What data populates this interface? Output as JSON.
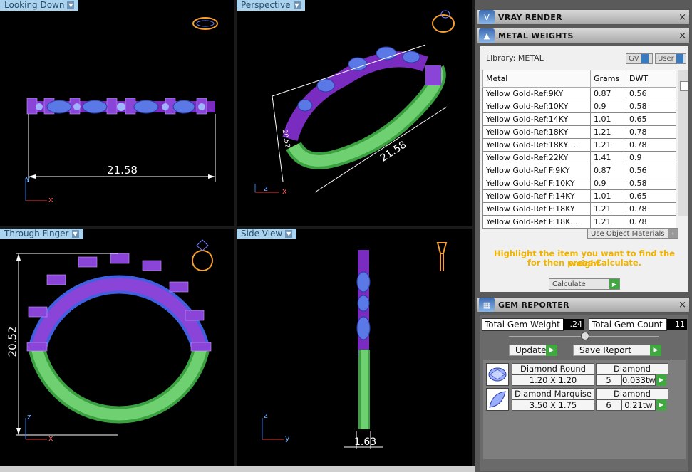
{
  "viewports": {
    "top_left": {
      "label": "Looking Down",
      "dim": "21.58",
      "axis1": "y",
      "axis2": "x"
    },
    "top_right": {
      "label": "Perspective",
      "dim": "21.58",
      "dim_small": "20.52",
      "axis1": "z",
      "axis2": "x"
    },
    "bottom_left": {
      "label": "Through Finger",
      "dim": "20.52",
      "axis1": "z",
      "axis2": "x"
    },
    "bottom_right": {
      "label": "Side View",
      "dim": "1.63",
      "axis1": "z",
      "axis2": "y"
    }
  },
  "panel": {
    "vray": {
      "title": "VRAY RENDER",
      "close": "×",
      "icon": "vray-icon"
    },
    "metal": {
      "title": "METAL WEIGHTS",
      "close": "×",
      "icon": "flask-icon",
      "library": "Library: METAL",
      "gv_label": "GV",
      "user_label": "User",
      "columns": [
        "Metal",
        "Grams",
        "DWT"
      ],
      "rows": [
        [
          "Yellow Gold-Ref:9KY",
          "0.87",
          "0.56"
        ],
        [
          "Yellow Gold-Ref:10KY",
          "0.9",
          "0.58"
        ],
        [
          "Yellow Gold-Ref:14KY",
          "1.01",
          "0.65"
        ],
        [
          "Yellow Gold-Ref:18KY",
          "1.21",
          "0.78"
        ],
        [
          "Yellow Gold-Ref:18KY ...",
          "1.21",
          "0.78"
        ],
        [
          "Yellow Gold-Ref:22KY",
          "1.41",
          "0.9"
        ],
        [
          "Yellow Gold-Ref F:9KY",
          "0.87",
          "0.56"
        ],
        [
          "Yellow Gold-Ref F:10KY",
          "0.9",
          "0.58"
        ],
        [
          "Yellow Gold-Ref F:14KY",
          "1.01",
          "0.65"
        ],
        [
          "Yellow Gold-Ref F:18KY",
          "1.21",
          "0.78"
        ],
        [
          "Yellow Gold-Ref F:18K...",
          "1.21",
          "0.78"
        ]
      ],
      "use_object_materials": "Use Object Materials",
      "hint_line1": "Highlight the item you want to find the weight",
      "hint_line2": "for then press Calculate.",
      "calculate": "Calculate"
    },
    "gem": {
      "title": "GEM REPORTER",
      "close": "×",
      "icon": "report-icon",
      "total_weight_label": "Total Gem Weight",
      "total_weight_value": ".24",
      "total_count_label": "Total Gem Count",
      "total_count_value": "11",
      "update": "Update",
      "save_report": "Save Report",
      "items": [
        {
          "name": "Diamond Round",
          "type": "Diamond",
          "size": "1.20 X 1.20",
          "count": "5",
          "weight": "0.033tw"
        },
        {
          "name": "Diamond Marquise",
          "type": "Diamond",
          "size": "3.50 X 1.75",
          "count": "6",
          "weight": "0.21tw"
        }
      ]
    }
  }
}
